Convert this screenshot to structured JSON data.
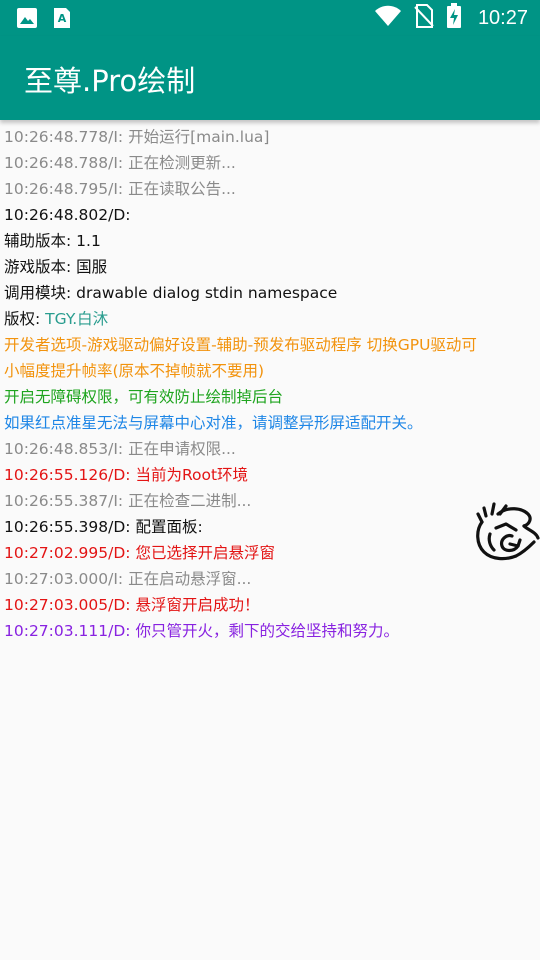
{
  "status_bar": {
    "time": "10:27",
    "icons": [
      "image-icon",
      "font-a-icon",
      "wifi-icon",
      "no-sim-icon",
      "battery-charging-icon"
    ]
  },
  "app_bar": {
    "title": "至尊.Pro绘制",
    "color": "#009485"
  },
  "log": [
    {
      "prefix": "10:26:48.778/I: ",
      "text": "开始运行[main.lua]",
      "color": "grey"
    },
    {
      "prefix": "10:26:48.788/I: ",
      "text": "正在检测更新...",
      "color": "grey"
    },
    {
      "prefix": "10:26:48.795/I: ",
      "text": "正在读取公告...",
      "color": "grey"
    },
    {
      "prefix": "10:26:48.802/D: ",
      "text": "",
      "color": "black"
    },
    {
      "prefix": "辅助版本: ",
      "text": "1.1",
      "color": "black"
    },
    {
      "prefix": "游戏版本: ",
      "text": "国服",
      "color": "black"
    },
    {
      "prefix": "调用模块: ",
      "text": "drawable dialog stdin namespace",
      "color": "black"
    },
    {
      "prefix": "版权: ",
      "text": "TGY.白沐",
      "color": "black",
      "text_color": "teal"
    },
    {
      "prefix": "",
      "text": "开发者选项-游戏驱动偏好设置-辅助-预发布驱动程序 切换GPU驱动可",
      "color": "orange"
    },
    {
      "prefix": "",
      "text": "小幅度提升帧率(原本不掉帧就不要用)",
      "color": "orange"
    },
    {
      "prefix": "",
      "text": "开启无障碍权限，可有效防止绘制掉后台",
      "color": "green"
    },
    {
      "prefix": "",
      "text": "如果红点准星无法与屏幕中心对准，请调整异形屏适配开关。",
      "color": "blue"
    },
    {
      "prefix": "10:26:48.853/I: ",
      "text": "正在申请权限...",
      "color": "grey"
    },
    {
      "prefix": "10:26:55.126/D: ",
      "text": "当前为Root环境",
      "color": "red"
    },
    {
      "prefix": "10:26:55.387/I: ",
      "text": "正在检查二进制...",
      "color": "grey"
    },
    {
      "prefix": "10:26:55.398/D: ",
      "text": "配置面板:",
      "color": "black"
    },
    {
      "prefix": "10:27:02.995/D: ",
      "text": "您已选择开启悬浮窗",
      "color": "red"
    },
    {
      "prefix": "10:27:03.000/I: ",
      "text": "正在启动悬浮窗...",
      "color": "grey"
    },
    {
      "prefix": "10:27:03.005/D: ",
      "text": "悬浮窗开启成功！",
      "color": "red"
    },
    {
      "prefix": "10:27:03.111/D: ",
      "text": "你只管开火，剩下的交给坚持和努力。",
      "color": "purple"
    }
  ],
  "floating_button": {
    "icon": "doodle-logo-icon"
  }
}
